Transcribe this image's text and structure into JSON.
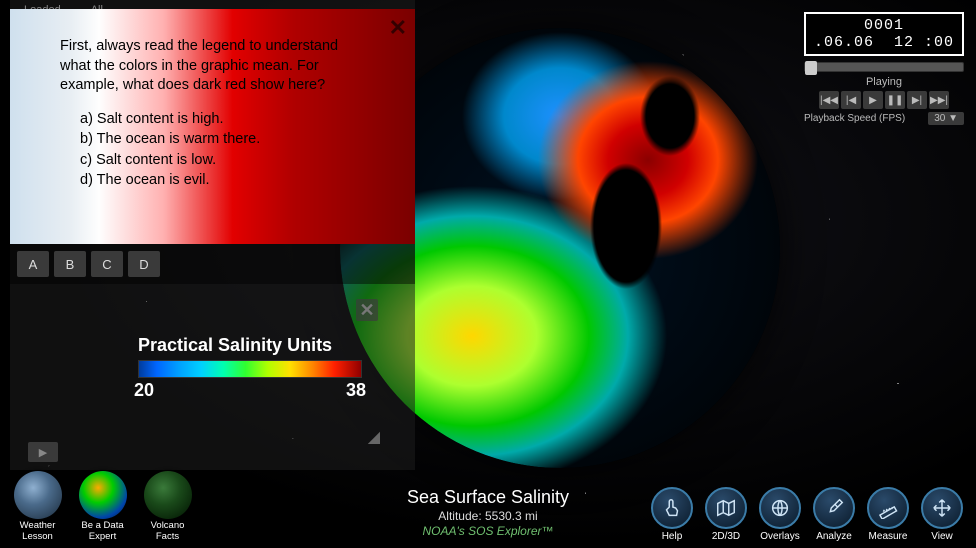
{
  "left_header": {
    "loaded": "Loaded",
    "all": "All"
  },
  "question": {
    "prompt": "First, always read the legend to understand what the colors in the graphic mean. For example, what does dark red show here?",
    "options": [
      "a) Salt content is high.",
      "b) The ocean is warm there.",
      "c) Salt content is low.",
      "d) The ocean is evil."
    ],
    "answers": [
      "A",
      "B",
      "C",
      "D"
    ]
  },
  "legend": {
    "title": "Practical Salinity Units",
    "min": "20",
    "max": "38"
  },
  "playback": {
    "time": "0001 .06.06  12 :00",
    "status": "Playing",
    "speed_label": "Playback Speed (FPS)",
    "speed_value": "30 ▼"
  },
  "title": {
    "main": "Sea Surface Salinity",
    "altitude": "Altitude: 5530.3 mi",
    "source": "NOAA's SOS Explorer™"
  },
  "datasets": [
    {
      "label": "Weather Lesson"
    },
    {
      "label": "Be a Data Expert"
    },
    {
      "label": "Volcano Facts"
    }
  ],
  "tools": [
    {
      "name": "help",
      "label": "Help"
    },
    {
      "name": "2d3d",
      "label": "2D/3D"
    },
    {
      "name": "overlays",
      "label": "Overlays"
    },
    {
      "name": "analyze",
      "label": "Analyze"
    },
    {
      "name": "measure",
      "label": "Measure"
    },
    {
      "name": "view",
      "label": "View"
    }
  ]
}
